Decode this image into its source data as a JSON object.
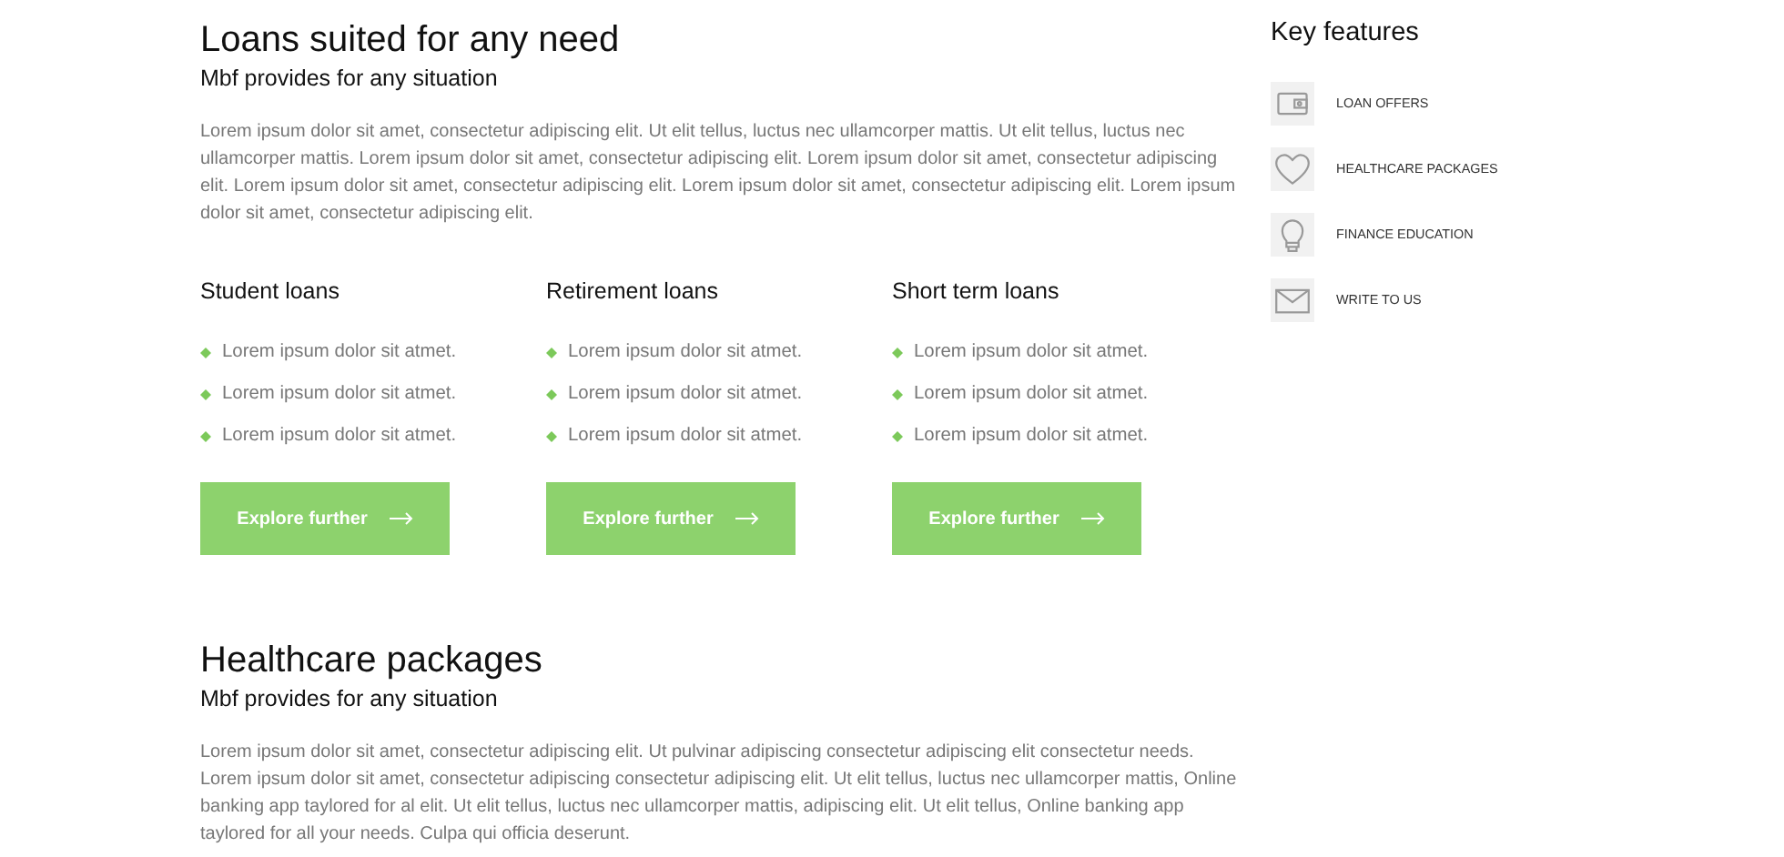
{
  "sections": [
    {
      "title": "Loans suited for any need",
      "subtitle": "Mbf provides for any situation",
      "text": "Lorem ipsum dolor sit amet, consectetur adipiscing elit. Ut elit tellus, luctus nec ullamcorper mattis. Ut elit tellus, luctus nec ullamcorper mattis. Lorem ipsum dolor sit amet, consectetur adipiscing elit. Lorem ipsum dolor sit amet, consectetur adipiscing elit. Lorem ipsum dolor sit amet, consectetur adipiscing elit. Lorem ipsum dolor sit amet, consectetur adipiscing elit. Lorem ipsum dolor sit amet, consectetur adipiscing elit.",
      "columns": [
        {
          "title": "Student loans",
          "items": [
            "Lorem ipsum dolor sit atmet.",
            "Lorem ipsum dolor sit atmet.",
            "Lorem ipsum dolor sit atmet."
          ],
          "button": "Explore further"
        },
        {
          "title": "Retirement loans",
          "items": [
            "Lorem ipsum dolor sit atmet.",
            "Lorem ipsum dolor sit atmet.",
            "Lorem ipsum dolor sit atmet."
          ],
          "button": "Explore further"
        },
        {
          "title": "Short term loans",
          "items": [
            "Lorem ipsum dolor sit atmet.",
            "Lorem ipsum dolor sit atmet.",
            "Lorem ipsum dolor sit atmet."
          ],
          "button": "Explore further"
        }
      ]
    },
    {
      "title": "Healthcare packages",
      "subtitle": "Mbf provides for any situation",
      "text": "Lorem ipsum dolor sit amet, consectetur adipiscing elit. Ut pulvinar adipiscing consectetur adipiscing elit consectetur needs. Lorem ipsum dolor sit amet, consectetur adipiscing consectetur adipiscing elit. Ut elit tellus, luctus nec ullamcorper mattis, Online banking app taylored for al elit. Ut elit tellus, luctus nec ullamcorper mattis, adipiscing elit. Ut elit tellus, Online banking app taylored for all your needs. Culpa qui officia deserunt."
    }
  ],
  "sidebar": {
    "title": "Key features",
    "items": [
      {
        "kind": "wallet",
        "label": "LOAN OFFERS"
      },
      {
        "kind": "heart",
        "label": "HEALTHCARE PACKAGES"
      },
      {
        "kind": "bulb",
        "label": "FINANCE EDUCATION"
      },
      {
        "kind": "mail",
        "label": "WRITE TO US"
      }
    ]
  }
}
